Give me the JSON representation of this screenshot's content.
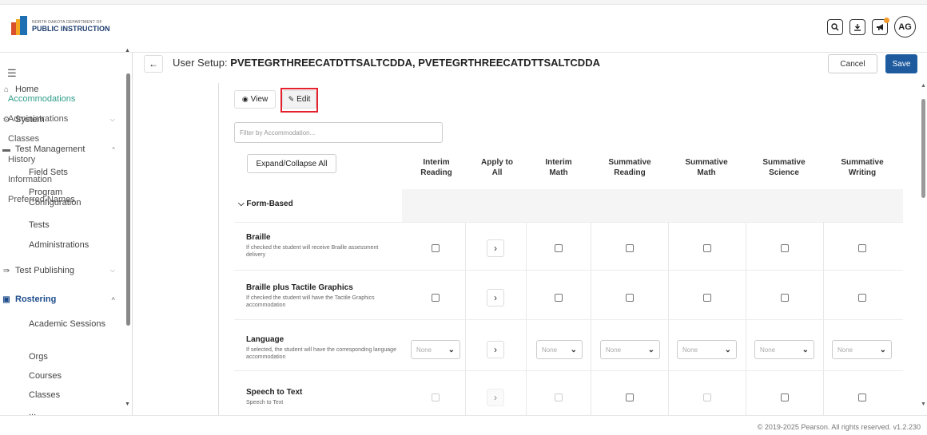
{
  "brand": {
    "line1": "NORTH DAKOTA DEPARTMENT OF",
    "line2": "PUBLIC INSTRUCTION"
  },
  "top_icons": [
    "search-icon",
    "download-icon",
    "megaphone-icon"
  ],
  "user_initials": "AG",
  "sidebar": {
    "items": [
      {
        "label": "Home",
        "icon": "home-icon"
      },
      {
        "label": "System",
        "icon": "gear-icon"
      },
      {
        "label": "Test Management",
        "icon": "folder-icon"
      },
      {
        "label": "Test Publishing",
        "icon": "publish-icon"
      },
      {
        "label": "Rostering",
        "icon": "roster-icon"
      }
    ],
    "test_management_sub": [
      "Field Sets",
      "Program Configuration",
      "Tests",
      "Administrations"
    ],
    "rostering_sub": [
      "Academic Sessions",
      "Orgs",
      "Courses",
      "Classes",
      "..."
    ]
  },
  "header": {
    "title_prefix": "User Setup:",
    "title_name": "PVETEGRTHREECATDTTSALTCDDA, PVETEGRTHREECATDTTSALTCDDA",
    "cancel": "Cancel",
    "save": "Save"
  },
  "subnav": [
    "Accommodations",
    "Administrations",
    "Classes",
    "History",
    "Information",
    "Preferred Names"
  ],
  "mode": {
    "view": "View",
    "edit": "Edit"
  },
  "filter_placeholder": "Filter by Accommodation...",
  "table": {
    "expand_label": "Expand/Collapse All",
    "columns": [
      [
        "Interim",
        "Reading"
      ],
      [
        "Apply to",
        "All"
      ],
      [
        "Interim",
        "Math"
      ],
      [
        "Summative",
        "Reading"
      ],
      [
        "Summative",
        "Math"
      ],
      [
        "Summative",
        "Science"
      ],
      [
        "Summative",
        "Writing"
      ]
    ],
    "group": "Form-Based",
    "rows": [
      {
        "title": "Braille",
        "desc": "If checked the student will receive Braille assessment delivery"
      },
      {
        "title": "Braille plus Tactile Graphics",
        "desc": "If checked the student will have the Tactile Graphics accommodation"
      },
      {
        "title": "Language",
        "desc": "If selected, the student will have the corresponding language accommodation",
        "select_value": "None"
      },
      {
        "title": "Speech to Text",
        "desc": "Speech to Text"
      }
    ]
  },
  "footer": "© 2019-2025 Pearson. All rights reserved. v1.2.230"
}
